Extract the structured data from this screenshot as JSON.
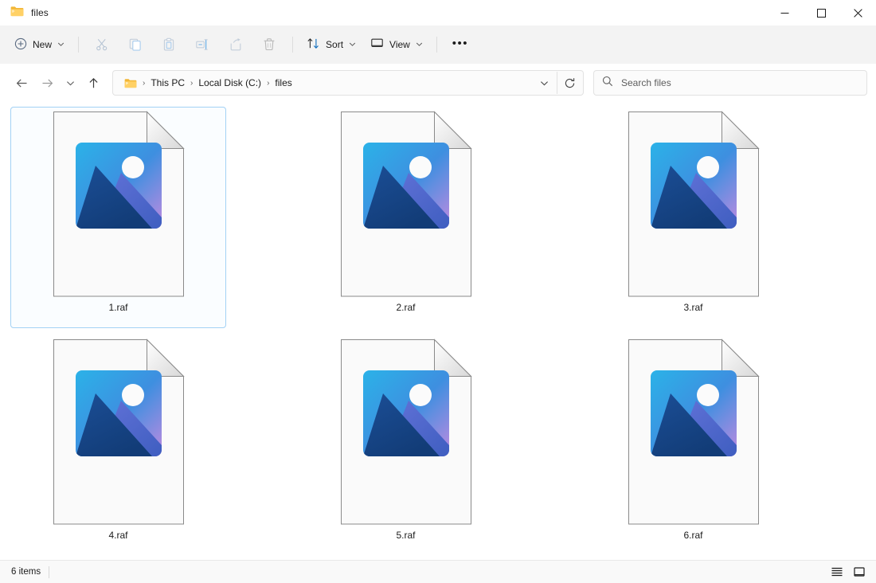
{
  "window": {
    "title": "files",
    "title_icon": "folder-icon",
    "controls": {
      "minimize": "—",
      "maximize": "☐",
      "close": "✕"
    }
  },
  "toolbar": {
    "new_label": "New",
    "new_icon": "plus-circle-icon",
    "commands": [
      {
        "name": "cut",
        "icon": "scissors-icon",
        "enabled": false
      },
      {
        "name": "copy",
        "icon": "copy-icon",
        "enabled": false
      },
      {
        "name": "paste",
        "icon": "clipboard-icon",
        "enabled": false
      },
      {
        "name": "rename",
        "icon": "rename-icon",
        "enabled": false
      },
      {
        "name": "share",
        "icon": "share-icon",
        "enabled": false
      },
      {
        "name": "delete",
        "icon": "trash-icon",
        "enabled": false
      }
    ],
    "sort_label": "Sort",
    "sort_icon": "sort-arrows-icon",
    "view_label": "View",
    "view_icon": "monitor-icon",
    "overflow_label": "•••"
  },
  "address": {
    "back_icon": "arrow-left-icon",
    "forward_icon": "arrow-right-icon",
    "recent_icon": "chevron-down-icon",
    "up_icon": "arrow-up-icon",
    "folder_icon": "folder-icon",
    "separator": "›",
    "crumbs": [
      "This PC",
      "Local Disk (C:)",
      "files"
    ],
    "dropdown_icon": "chevron-down-icon",
    "refresh_icon": "refresh-icon"
  },
  "search": {
    "placeholder": "Search files",
    "value": "",
    "icon": "search-icon"
  },
  "files": [
    {
      "name": "1.raf",
      "icon": "image-file-icon",
      "selected": true
    },
    {
      "name": "2.raf",
      "icon": "image-file-icon",
      "selected": false
    },
    {
      "name": "3.raf",
      "icon": "image-file-icon",
      "selected": false
    },
    {
      "name": "4.raf",
      "icon": "image-file-icon",
      "selected": false
    },
    {
      "name": "5.raf",
      "icon": "image-file-icon",
      "selected": false
    },
    {
      "name": "6.raf",
      "icon": "image-file-icon",
      "selected": false
    }
  ],
  "status": {
    "item_count": "6 items",
    "details_view_icon": "list-view-icon",
    "large_icons_view_icon": "large-icons-view-icon"
  },
  "colors": {
    "accent": "#0078d4",
    "selection_border": "#a3d2f5",
    "selection_fill": "#fafdff",
    "folder_yellow": "#f7c35a",
    "toolbar_bg": "#f3f3f3",
    "thumb_sky_start": "#29ace3",
    "thumb_sky_end": "#b78ae0",
    "thumb_mountain_dark": "#12457f",
    "thumb_mountain_light": "#5566cf"
  }
}
